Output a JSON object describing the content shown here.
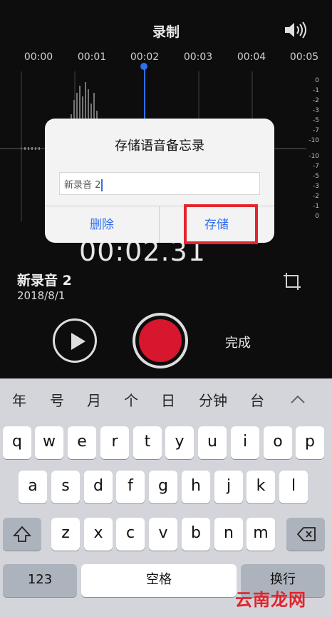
{
  "recorder": {
    "title": "录制",
    "timeline_ticks": [
      "00:00",
      "00:01",
      "00:02",
      "00:03",
      "00:04",
      "00:05"
    ],
    "db_scale": [
      "0",
      "-1",
      "-2",
      "-3",
      "-5",
      "-7",
      "-10",
      "-10",
      "-7",
      "-5",
      "-3",
      "-2",
      "-1",
      "0"
    ],
    "timer": "00:02.31",
    "recording_name": "新录音 2",
    "recording_date": "2018/8/1",
    "done_label": "完成"
  },
  "dialog": {
    "title": "存储语音备忘录",
    "input_value": "新录音 2",
    "delete_label": "删除",
    "save_label": "存储"
  },
  "keyboard": {
    "candidates": [
      "年",
      "号",
      "月",
      "个",
      "日",
      "分钟",
      "台"
    ],
    "row1": [
      "q",
      "w",
      "e",
      "r",
      "t",
      "y",
      "u",
      "i",
      "o",
      "p"
    ],
    "row2": [
      "a",
      "s",
      "d",
      "f",
      "g",
      "h",
      "j",
      "k",
      "l"
    ],
    "row3": [
      "z",
      "x",
      "c",
      "v",
      "b",
      "n",
      "m"
    ],
    "num_key": "123",
    "space_key": "空格",
    "return_key": "换行"
  },
  "watermark": "云南龙网",
  "colors": {
    "accent_blue": "#2f6ff0",
    "record_red": "#d7172d",
    "highlight_red": "#e3262d"
  }
}
